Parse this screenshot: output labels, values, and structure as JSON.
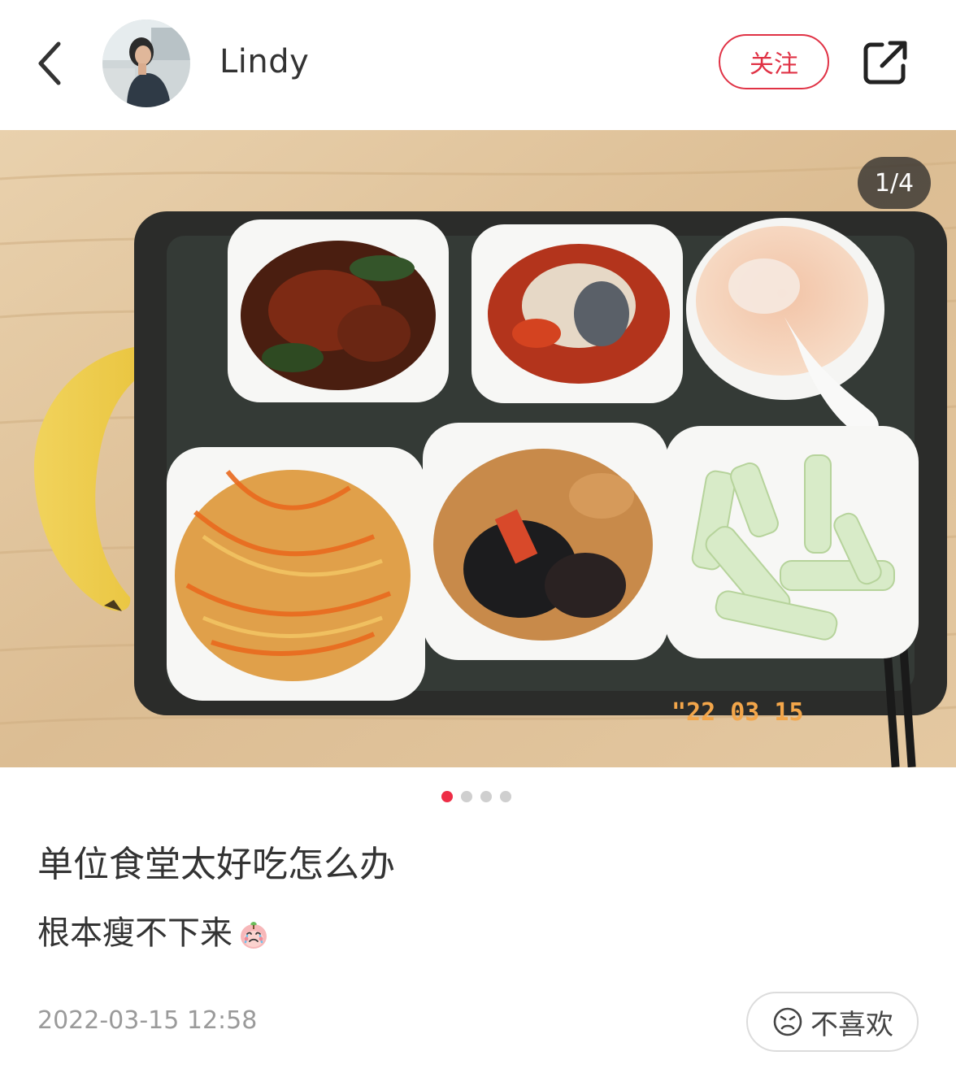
{
  "header": {
    "back_icon": "chevron-left-icon",
    "username": "Lindy",
    "follow_label": "关注",
    "share_icon": "share-external-icon"
  },
  "photo": {
    "page_indicator": "1/4",
    "date_stamp": "\"22 03 15",
    "total_pages": 4,
    "current_page": 1
  },
  "post": {
    "title": "单位食堂太好吃怎么办",
    "description": "根本瘦不下来",
    "description_emoji": "crying-peach-emoji",
    "timestamp": "2022-03-15 12:58"
  },
  "actions": {
    "dislike_label": "不喜欢",
    "dislike_icon": "sad-face-icon"
  },
  "colors": {
    "accent": "#ee2d46",
    "follow_border": "#e03245",
    "text_primary": "#333333",
    "text_secondary": "#9a9a9a"
  }
}
